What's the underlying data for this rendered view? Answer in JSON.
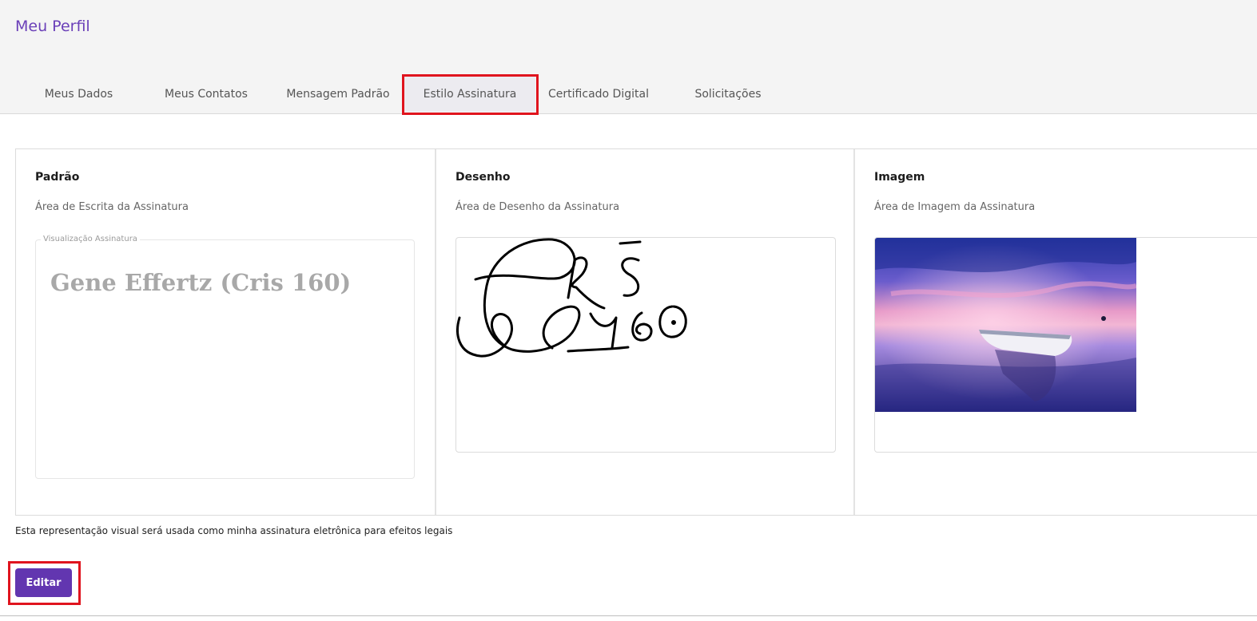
{
  "header": {
    "title": "Meu Perfil"
  },
  "tabs": [
    {
      "label": "Meus Dados",
      "active": false
    },
    {
      "label": "Meus Contatos",
      "active": false
    },
    {
      "label": "Mensagem Padrão",
      "active": false
    },
    {
      "label": "Estilo Assinatura",
      "active": true
    },
    {
      "label": "Certificado Digital",
      "active": false
    },
    {
      "label": "Solicitações",
      "active": false
    }
  ],
  "panels": {
    "standard": {
      "title": "Padrão",
      "subtitle": "Área de Escrita da Assinatura",
      "legend": "Visualização Assinatura",
      "signature_text": "Gene Effertz (Cris 160)"
    },
    "drawing": {
      "title": "Desenho",
      "subtitle": "Área de Desenho da Assinatura"
    },
    "image": {
      "title": "Imagem",
      "subtitle": "Área de Imagem da Assinatura"
    }
  },
  "legal_note": "Esta representação visual será usada como minha assinatura eletrônica para efeitos legais",
  "edit_button": {
    "label": "Editar"
  },
  "colors": {
    "accent": "#6236b0",
    "title": "#6a3fb8",
    "highlight": "#e0141e"
  }
}
